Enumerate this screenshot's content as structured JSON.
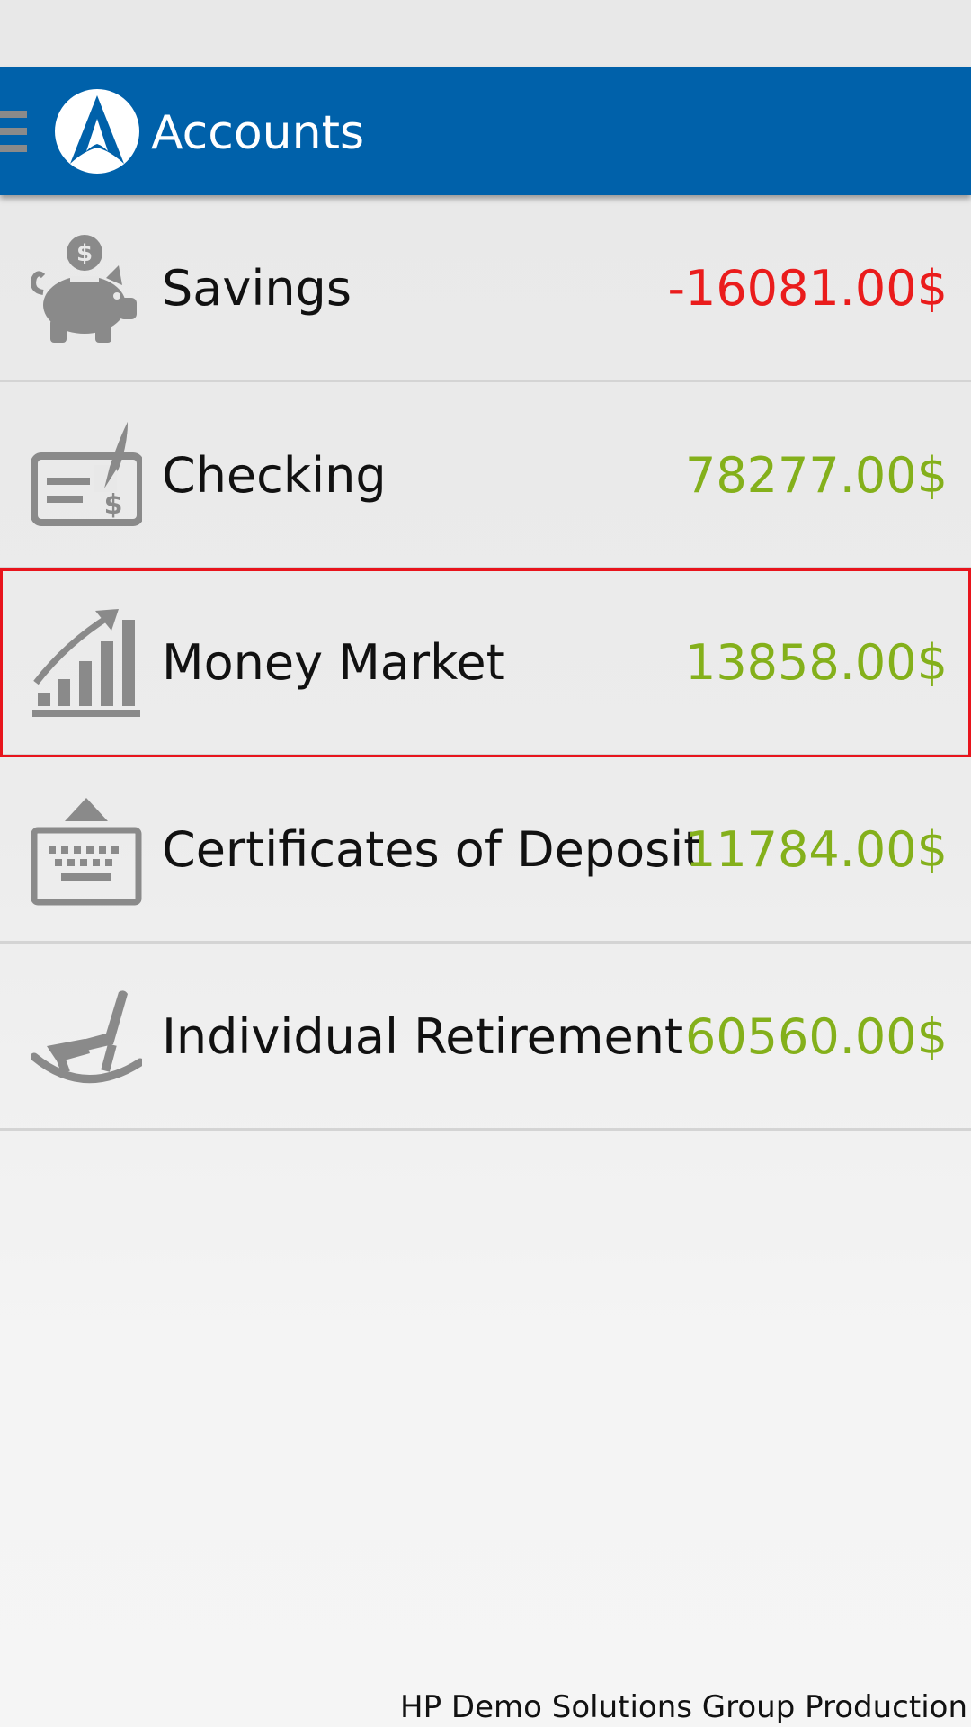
{
  "app_bar": {
    "title": "Accounts",
    "color": "#0061aa",
    "menu_icon": "hamburger-menu-icon",
    "logo_icon": "app-logo-icon"
  },
  "accounts": [
    {
      "name": "Savings",
      "amount": "-16081.00$",
      "amount_color": "#ea1c1c",
      "icon": "piggy-bank-icon",
      "selected": false
    },
    {
      "name": "Checking",
      "amount": "78277.00$",
      "amount_color": "#84b01b",
      "icon": "check-pen-icon",
      "selected": false
    },
    {
      "name": "Money Market",
      "amount": "13858.00$",
      "amount_color": "#84b01b",
      "icon": "growth-chart-icon",
      "selected": true
    },
    {
      "name": "Certificates of Deposit",
      "amount": "11784.00$",
      "amount_color": "#84b01b",
      "icon": "keyboard-deposit-icon",
      "selected": false
    },
    {
      "name": "Individual Retirement",
      "amount": "60560.00$",
      "amount_color": "#84b01b",
      "icon": "rocking-chair-icon",
      "selected": false
    }
  ],
  "footer": {
    "text": "HP Demo Solutions Group Production"
  }
}
